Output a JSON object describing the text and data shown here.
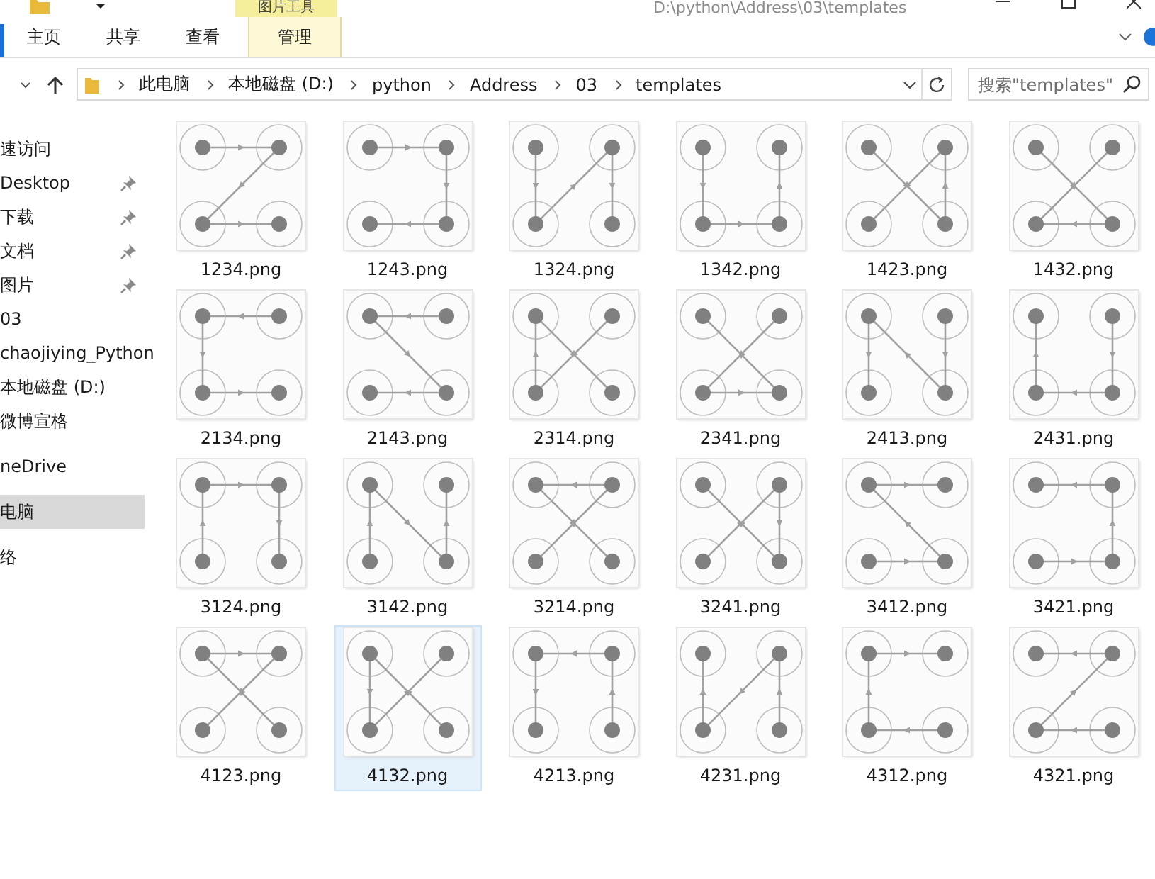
{
  "title_bar": {
    "context_tab": "图片工具",
    "title": "D:\\python\\Address\\03\\templates"
  },
  "ribbon_tabs": [
    {
      "label": "主页",
      "kind": "normal",
      "selected": false
    },
    {
      "label": "共享",
      "kind": "normal",
      "selected": false
    },
    {
      "label": "查看",
      "kind": "normal",
      "selected": false
    },
    {
      "label": "管理",
      "kind": "contextual",
      "selected": false
    }
  ],
  "address_bar": {
    "breadcrumbs": [
      "此电脑",
      "本地磁盘 (D:)",
      "python",
      "Address",
      "03",
      "templates"
    ]
  },
  "search": {
    "placeholder": "搜索\"templates\""
  },
  "nav_sections": [
    {
      "items": [
        {
          "label": "速访问",
          "pinned": false,
          "selected": false
        },
        {
          "label": "Desktop",
          "pinned": true,
          "selected": false
        },
        {
          "label": "下载",
          "pinned": true,
          "selected": false
        },
        {
          "label": "文档",
          "pinned": true,
          "selected": false
        },
        {
          "label": "图片",
          "pinned": true,
          "selected": false
        },
        {
          "label": "03",
          "pinned": false,
          "selected": false
        },
        {
          "label": "chaojiying_Python",
          "pinned": false,
          "selected": false
        },
        {
          "label": "本地磁盘 (D:)",
          "pinned": false,
          "selected": false
        },
        {
          "label": "微博宣格",
          "pinned": false,
          "selected": false
        }
      ]
    },
    {
      "items": [
        {
          "label": "neDrive",
          "pinned": false,
          "selected": false
        }
      ]
    },
    {
      "items": [
        {
          "label": "电脑",
          "pinned": false,
          "selected": true
        }
      ]
    },
    {
      "items": [
        {
          "label": "络",
          "pinned": false,
          "selected": false
        }
      ]
    }
  ],
  "files": [
    {
      "label": "1234.png",
      "selected": false
    },
    {
      "label": "1243.png",
      "selected": false
    },
    {
      "label": "1324.png",
      "selected": false
    },
    {
      "label": "1342.png",
      "selected": false
    },
    {
      "label": "1423.png",
      "selected": false
    },
    {
      "label": "1432.png",
      "selected": false
    },
    {
      "label": "2134.png",
      "selected": false
    },
    {
      "label": "2143.png",
      "selected": false
    },
    {
      "label": "2314.png",
      "selected": false
    },
    {
      "label": "2341.png",
      "selected": false
    },
    {
      "label": "2413.png",
      "selected": false
    },
    {
      "label": "2431.png",
      "selected": false
    },
    {
      "label": "3124.png",
      "selected": false
    },
    {
      "label": "3142.png",
      "selected": false
    },
    {
      "label": "3214.png",
      "selected": false
    },
    {
      "label": "3241.png",
      "selected": false
    },
    {
      "label": "3412.png",
      "selected": false
    },
    {
      "label": "3421.png",
      "selected": false
    },
    {
      "label": "4123.png",
      "selected": false
    },
    {
      "label": "4132.png",
      "selected": true
    },
    {
      "label": "4213.png",
      "selected": false
    },
    {
      "label": "4231.png",
      "selected": false
    },
    {
      "label": "4312.png",
      "selected": false
    },
    {
      "label": "4321.png",
      "selected": false
    }
  ]
}
